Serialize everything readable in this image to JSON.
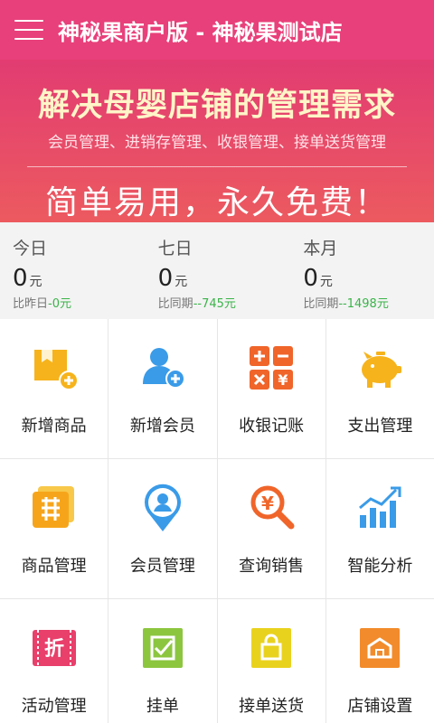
{
  "header": {
    "title": "神秘果商户版 - 神秘果测试店"
  },
  "banner": {
    "headline": "解决母婴店铺的管理需求",
    "subline": "会员管理、进销存管理、收银管理、接单送货管理",
    "slogan": "简单易用，永久免费！"
  },
  "stats": [
    {
      "label": "今日",
      "value": "0",
      "unit": "元",
      "compare_label": "比昨日",
      "delta": "-0元"
    },
    {
      "label": "七日",
      "value": "0",
      "unit": "元",
      "compare_label": "比同期",
      "delta": "--745元"
    },
    {
      "label": "本月",
      "value": "0",
      "unit": "元",
      "compare_label": "比同期",
      "delta": "--1498元"
    }
  ],
  "grid": [
    {
      "label": "新增商品",
      "icon": "add-product-icon"
    },
    {
      "label": "新增会员",
      "icon": "add-member-icon"
    },
    {
      "label": "收银记账",
      "icon": "calculator-icon"
    },
    {
      "label": "支出管理",
      "icon": "piggy-bank-icon"
    },
    {
      "label": "商品管理",
      "icon": "product-grid-icon"
    },
    {
      "label": "会员管理",
      "icon": "member-location-icon"
    },
    {
      "label": "查询销售",
      "icon": "search-sales-icon"
    },
    {
      "label": "智能分析",
      "icon": "chart-icon"
    },
    {
      "label": "活动管理",
      "icon": "discount-ticket-icon"
    },
    {
      "label": "挂单",
      "icon": "hold-order-icon"
    },
    {
      "label": "接单送货",
      "icon": "shopping-bag-icon"
    },
    {
      "label": "店铺设置",
      "icon": "store-settings-icon"
    }
  ],
  "colors": {
    "header": "#e8407a",
    "accent_green": "#3bb34a"
  }
}
